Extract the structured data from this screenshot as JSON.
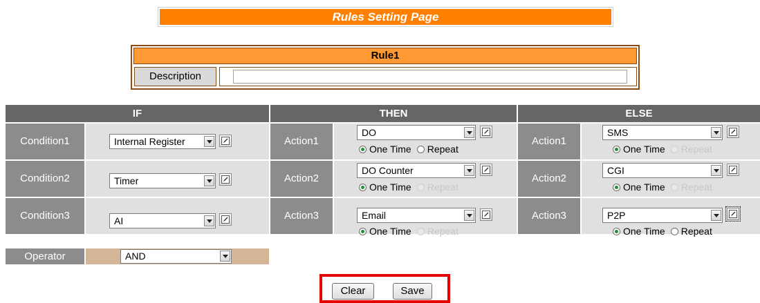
{
  "page": {
    "title": "Rules Setting Page"
  },
  "rule": {
    "name": "Rule1",
    "description_label": "Description",
    "description_value": ""
  },
  "headers": {
    "if": "IF",
    "then": "THEN",
    "else": "ELSE"
  },
  "conditions": [
    {
      "label": "Condition1",
      "value": "Internal Register"
    },
    {
      "label": "Condition2",
      "value": "Timer"
    },
    {
      "label": "Condition3",
      "value": "AI"
    }
  ],
  "then_actions": [
    {
      "label": "Action1",
      "value": "DO",
      "one_time": "One Time",
      "repeat": "Repeat"
    },
    {
      "label": "Action2",
      "value": "DO Counter",
      "one_time": "One Time",
      "repeat": "Repeat"
    },
    {
      "label": "Action3",
      "value": "Email",
      "one_time": "One Time",
      "repeat": "Repeat"
    }
  ],
  "else_actions": [
    {
      "label": "Action1",
      "value": "SMS",
      "one_time": "One Time",
      "repeat": "Repeat"
    },
    {
      "label": "Action2",
      "value": "CGI",
      "one_time": "One Time",
      "repeat": "Repeat"
    },
    {
      "label": "Action3",
      "value": "P2P",
      "one_time": "One Time",
      "repeat": "Repeat"
    }
  ],
  "operator": {
    "label": "Operator",
    "value": "AND"
  },
  "buttons": {
    "clear": "Clear",
    "save": "Save"
  },
  "colors": {
    "title_bg": "#ff7f00",
    "rule_header_bg": "#ff9933",
    "section_header_bg": "#666666",
    "label_bg": "#8c8c8c",
    "cell_bg": "#e0e0e0",
    "operator_bg": "#d4b596",
    "highlight_frame": "#e60000"
  },
  "icons": {
    "edit": "edit-icon",
    "dropdown": "chevron-down-icon"
  }
}
